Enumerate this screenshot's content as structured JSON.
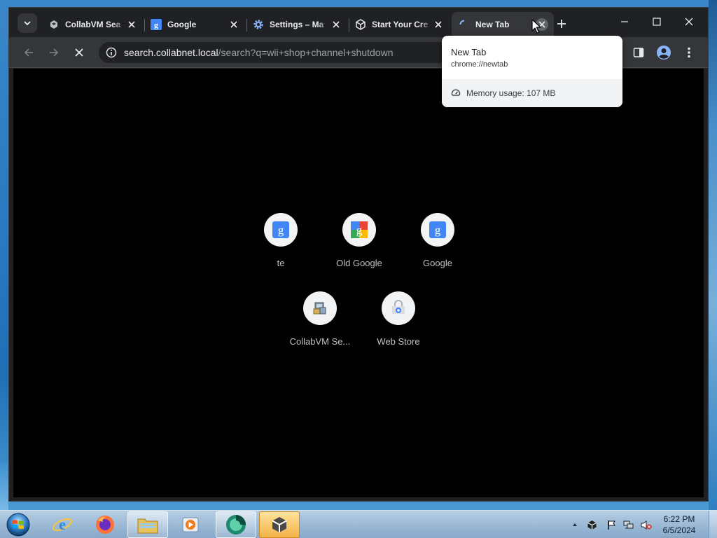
{
  "browser": {
    "tabs": [
      {
        "title": "CollabVM Sea",
        "favicon": "collabvm-icon",
        "active": false
      },
      {
        "title": "Google",
        "favicon": "google-g-icon",
        "active": false
      },
      {
        "title": "Settings – Ma",
        "favicon": "settings-gear-icon",
        "active": false
      },
      {
        "title": "Start Your Cre",
        "favicon": "unity-icon",
        "active": false
      },
      {
        "title": "New Tab",
        "favicon": "loading-spinner-icon",
        "active": true
      }
    ],
    "toolbar": {
      "url_host": "search.collabnet.local",
      "url_path": "/search?q=wii+shop+channel+shutdown"
    },
    "hovercard": {
      "title": "New Tab",
      "url": "chrome://newtab",
      "memory": "Memory usage: 107 MB"
    },
    "shortcuts": [
      {
        "label": "te",
        "icon": "google-g-icon"
      },
      {
        "label": "Old Google",
        "icon": "old-google-icon"
      },
      {
        "label": "Google",
        "icon": "google-g-icon"
      },
      {
        "label": "CollabVM Se...",
        "icon": "collabvm-icon"
      },
      {
        "label": "Web Store",
        "icon": "web-store-icon"
      }
    ]
  },
  "taskbar": {
    "apps": [
      "internet-explorer-icon",
      "firefox-icon",
      "file-explorer-icon",
      "media-player-icon",
      "browser-app-icon",
      "unity-icon"
    ],
    "clock_time": "6:22 PM",
    "clock_date": "6/5/2024"
  },
  "colors": {
    "chrome_dark": "#202124",
    "toolbar": "#35363a",
    "google_blue": "#4285f4",
    "taskbar": "#9fbcd8"
  }
}
